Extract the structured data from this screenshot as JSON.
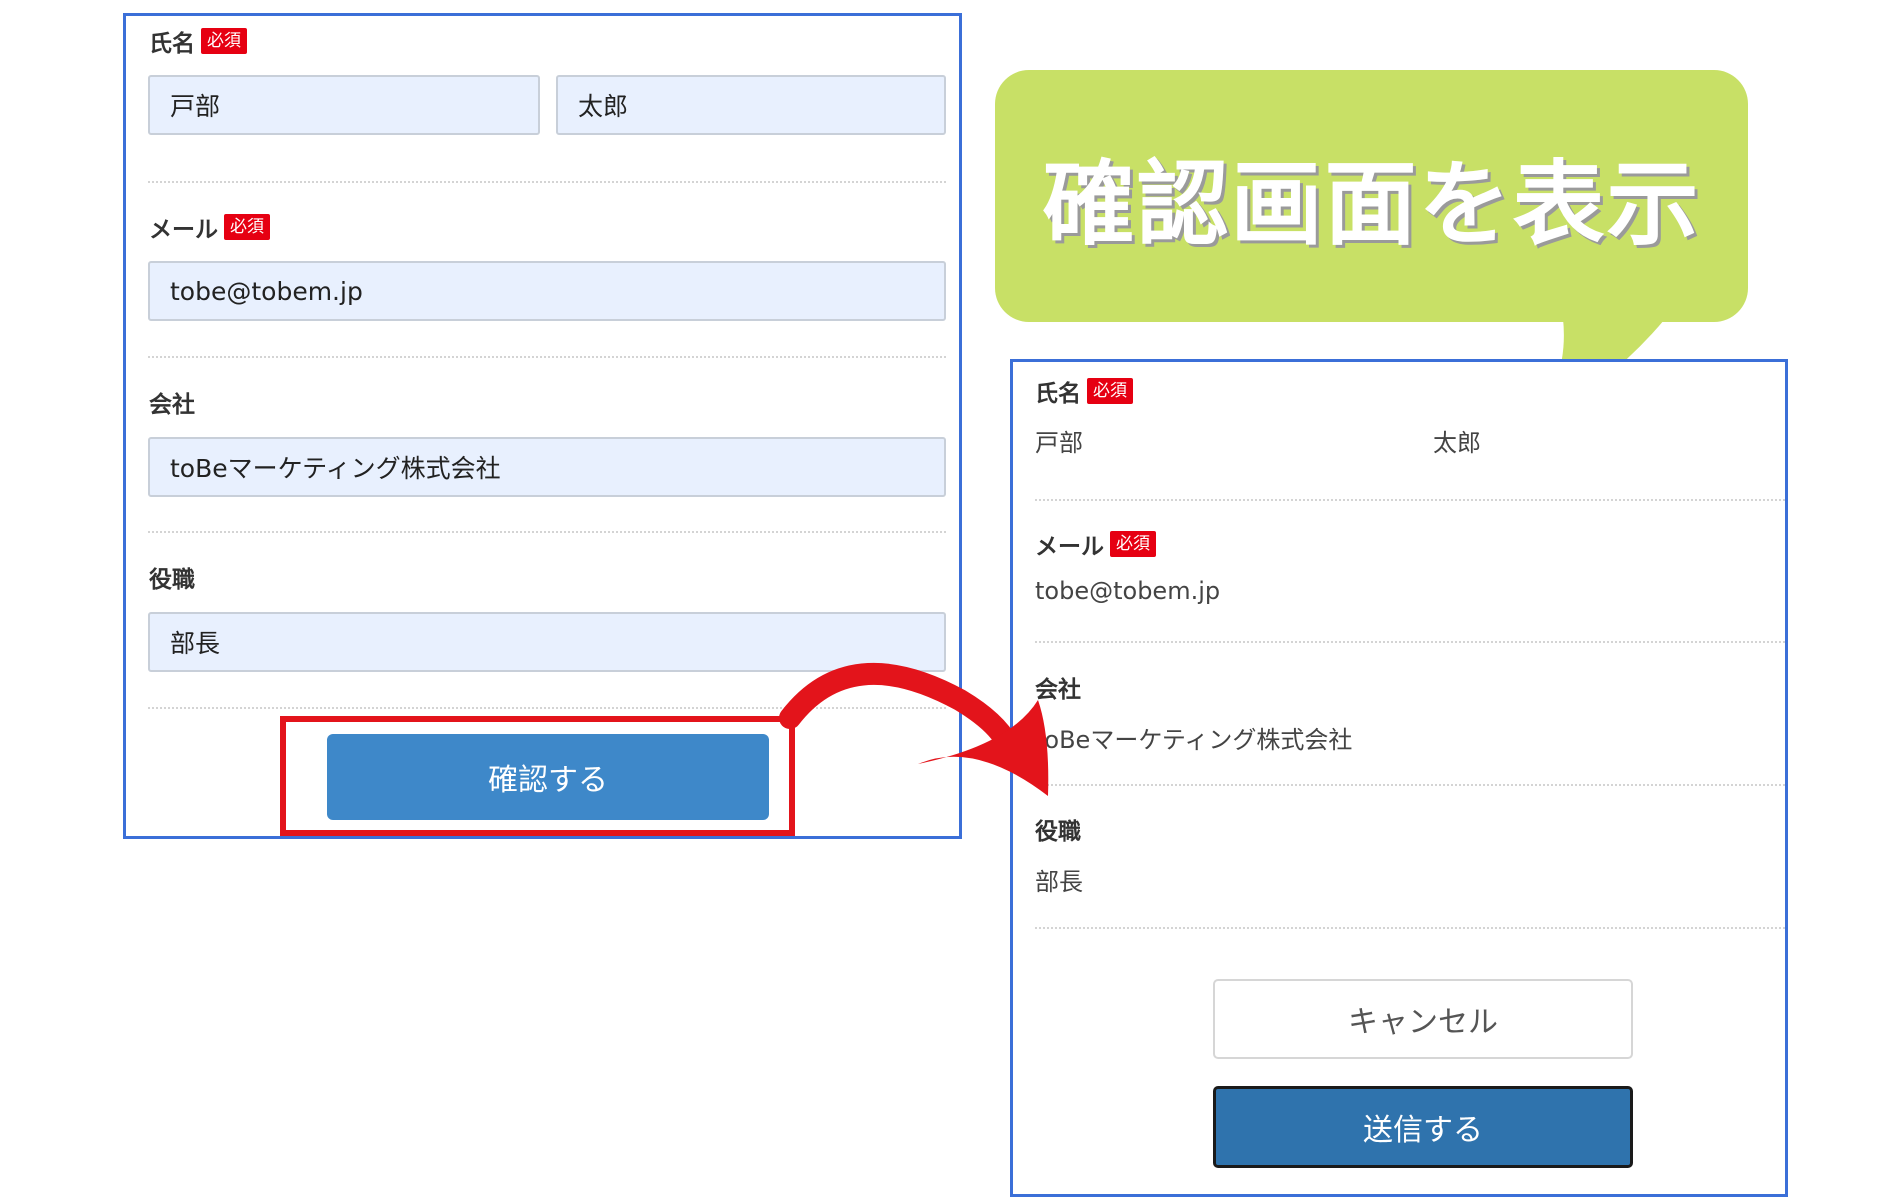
{
  "colors": {
    "panel_border": "#3b6fd8",
    "required_badge": "#e60012",
    "input_bg": "#e8f0fe",
    "confirm_button": "#3e88c9",
    "send_button": "#2f73ad",
    "highlight": "#e3141b",
    "bubble": "#c8e066"
  },
  "callout": {
    "text": "確認画面を表示"
  },
  "entry_form": {
    "name": {
      "label": "氏名",
      "required": "必須",
      "last": "戸部",
      "first": "太郎"
    },
    "email": {
      "label": "メール",
      "required": "必須",
      "value": "tobe@tobem.jp"
    },
    "company": {
      "label": "会社",
      "value": "toBeマーケティング株式会社"
    },
    "title": {
      "label": "役職",
      "value": "部長"
    },
    "confirm_button": "確認する"
  },
  "confirm_screen": {
    "name": {
      "label": "氏名",
      "required": "必須",
      "last": "戸部",
      "first": "太郎"
    },
    "email": {
      "label": "メール",
      "required": "必須",
      "value": "tobe@tobem.jp"
    },
    "company": {
      "label": "会社",
      "value": "toBeマーケティング株式会社"
    },
    "title": {
      "label": "役職",
      "value": "部長"
    },
    "cancel_button": "キャンセル",
    "send_button": "送信する"
  }
}
